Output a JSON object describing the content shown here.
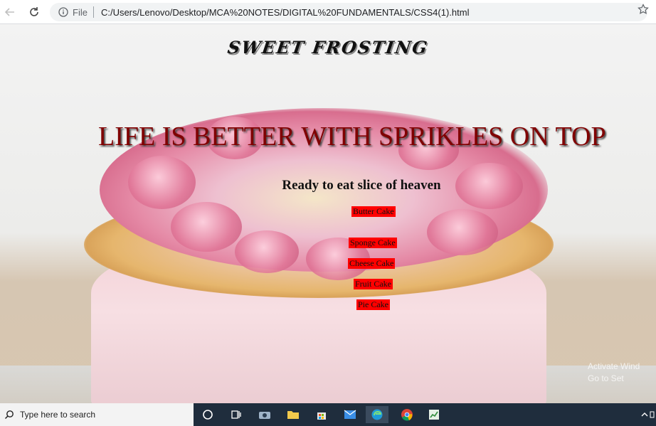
{
  "browser": {
    "file_label": "File",
    "url": "C:/Users/Lenovo/Desktop/MCA%20NOTES/DIGITAL%20FUNDAMENTALS/CSS4(1).html"
  },
  "page": {
    "logo": "SWEET FROSTING",
    "headline": "LIFE IS BETTER WITH SPRIKLES ON TOP",
    "subheading": "Ready to eat slice of heaven",
    "menu": [
      "Butter Cake",
      "Sponge Cake",
      "Cheese Cake",
      "Fruit Cake",
      "Pie Cake"
    ],
    "watermark": [
      "Activate Wind",
      "Go to Set"
    ]
  },
  "taskbar": {
    "search_placeholder": "Type here to search"
  },
  "colors": {
    "headline": "#800000",
    "menu_bg": "#ff0000",
    "taskbar": "#1f2d3d"
  }
}
